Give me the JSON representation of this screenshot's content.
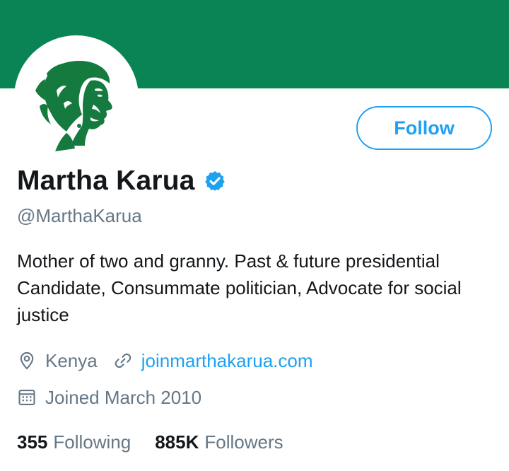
{
  "colors": {
    "banner": "#0a8454",
    "accent": "#1da1f2",
    "avatar_art": "#157a3e",
    "text_primary": "#14171a",
    "text_secondary": "#657786"
  },
  "profile": {
    "display_name": "Martha Karua",
    "verified": true,
    "handle": "@MarthaKarua",
    "bio": "Mother of two and granny. Past & future presidential Candidate, Consummate politician, Advocate for social justice",
    "location": "Kenya",
    "website": "joinmarthakarua.com",
    "joined": "Joined March 2010"
  },
  "actions": {
    "follow_label": "Follow"
  },
  "stats": {
    "following_count": "355",
    "following_label": "Following",
    "followers_count": "885K",
    "followers_label": "Followers"
  },
  "icons": {
    "location": "location-pin-icon",
    "link": "link-icon",
    "calendar": "calendar-icon",
    "verified": "verified-badge-icon"
  }
}
